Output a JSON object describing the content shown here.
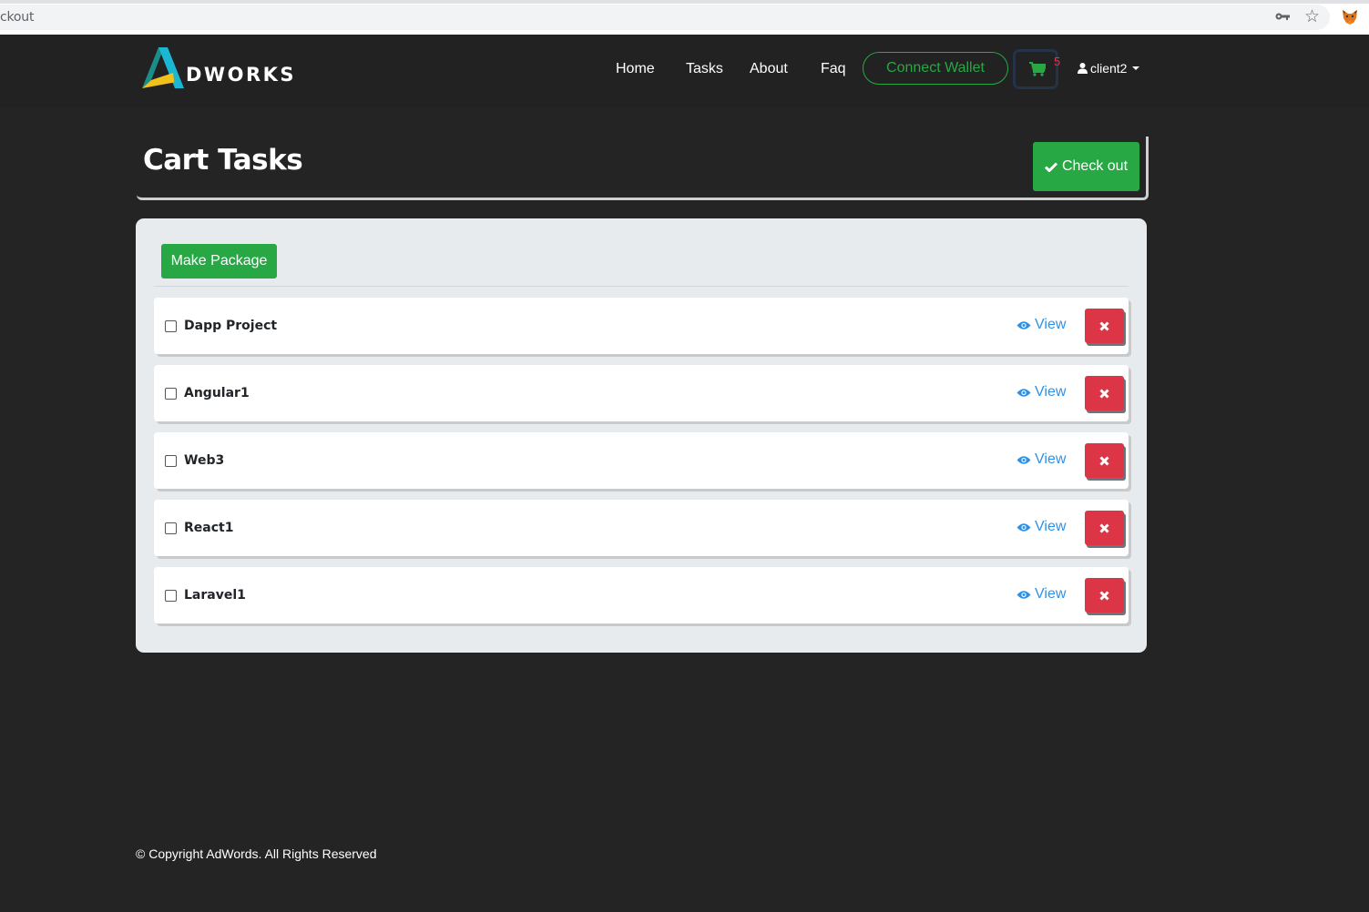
{
  "browser": {
    "url_text": "ckout",
    "icons": [
      "key-icon",
      "star-icon",
      "metamask-fox-icon"
    ]
  },
  "navbar": {
    "brand": "DWORKS",
    "links": [
      "Home",
      "Tasks",
      "About",
      "Faq"
    ],
    "connect_wallet_label": "Connect Wallet",
    "cart_count": "5",
    "user_label": "client2"
  },
  "page": {
    "title": "Cart Tasks",
    "checkout_label": "Check out"
  },
  "panel": {
    "make_package_label": "Make Package",
    "view_label": "View",
    "tasks": [
      {
        "name": "Dapp Project",
        "checked": false
      },
      {
        "name": "Angular1",
        "checked": false
      },
      {
        "name": "Web3",
        "checked": false
      },
      {
        "name": "React1",
        "checked": false
      },
      {
        "name": "Laravel1",
        "checked": false
      }
    ]
  },
  "colors": {
    "success": "#28a745",
    "danger": "#dc3545",
    "link": "#2f91e6",
    "background": "#242424",
    "panel": "#e8ebee"
  },
  "footer": {
    "text": "© Copyright AdWords. All Rights Reserved"
  }
}
